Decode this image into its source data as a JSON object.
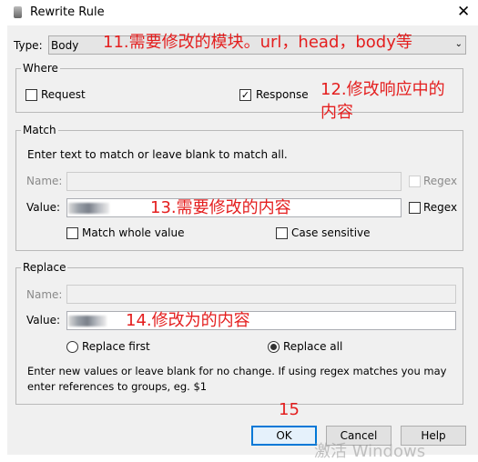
{
  "window": {
    "title": "Rewrite Rule",
    "close_icon": "close-icon",
    "app_icon": "fiddler-icon"
  },
  "type": {
    "label": "Type:",
    "selected": "Body"
  },
  "where": {
    "legend": "Where",
    "request": {
      "label": "Request",
      "checked": false
    },
    "response": {
      "label": "Response",
      "checked": true
    }
  },
  "match": {
    "legend": "Match",
    "hint": "Enter text to match or leave blank to match all.",
    "name_label": "Name:",
    "name_value": "",
    "name_regex": "Regex",
    "value_label": "Value:",
    "value_regex": "Regex",
    "match_whole": "Match whole value",
    "case_sensitive": "Case sensitive"
  },
  "replace": {
    "legend": "Replace",
    "name_label": "Name:",
    "value_label": "Value:",
    "replace_first": "Replace first",
    "replace_all": "Replace all",
    "selected": "Replace all",
    "hint1": "Enter new values or leave blank for no change. If using regex matches you may",
    "hint2": "enter references to groups, eg. $1"
  },
  "buttons": {
    "ok": "OK",
    "cancel": "Cancel",
    "help": "Help"
  },
  "annotations": {
    "a11": "11.需要修改的模块。url，head，body等",
    "a12_1": "12.修改响应中的",
    "a12_2": "内容",
    "a13": "13.需要修改的内容",
    "a14": "14.修改为的内容",
    "a15": "15"
  },
  "watermark": "激活 Windows",
  "colors": {
    "annotation": "#e41e1e",
    "default_button_border": "#0078d7"
  }
}
